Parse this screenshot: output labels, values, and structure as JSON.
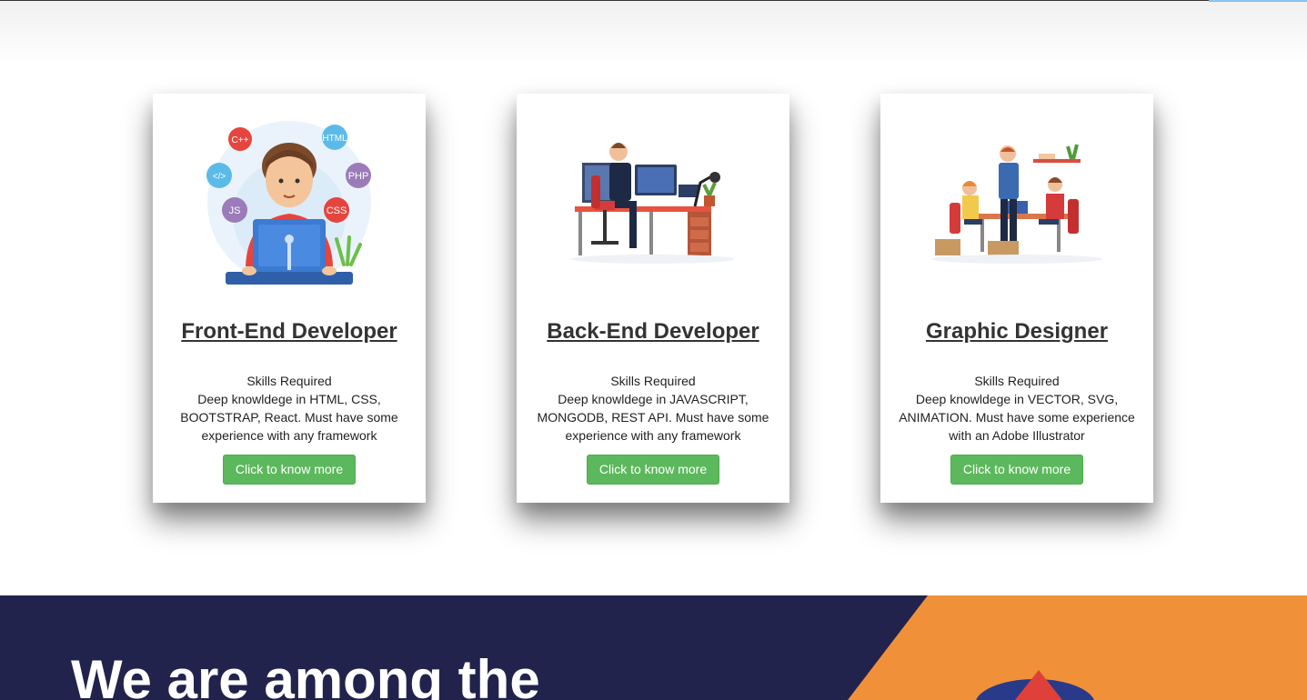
{
  "colors": {
    "button": "#5cb85c",
    "banner_bg": "#22234c",
    "banner_accent": "#f0913a"
  },
  "cards": [
    {
      "title": "Front-End Developer",
      "skills_heading": "Skills Required",
      "skills_text": "Deep knowldege in HTML, CSS, BOOTSTRAP, React. Must have some experience with any framework",
      "button_label": "Click to know more",
      "image_badges": [
        "C++",
        "HTML",
        "PHP",
        "CSS",
        "JS",
        "</>"
      ]
    },
    {
      "title": "Back-End Developer",
      "skills_heading": "Skills Required",
      "skills_text": "Deep knowldege in JAVASCRIPT, MONGODB, REST API. Must have some experience with any framework",
      "button_label": "Click to know more"
    },
    {
      "title": "Graphic Designer",
      "skills_heading": "Skills Required",
      "skills_text": "Deep knowldege in VECTOR, SVG, ANIMATION. Must have some experience with an Adobe Illustrator",
      "button_label": "Click to know more"
    }
  ],
  "banner": {
    "heading": "We are among the"
  }
}
